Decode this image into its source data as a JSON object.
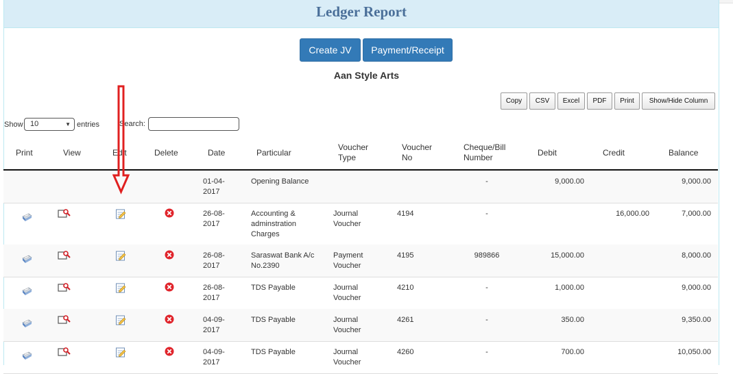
{
  "header": {
    "title": "Ledger Report"
  },
  "actions": {
    "create_jv": "Create JV",
    "payment_receipt": "Payment/Receipt"
  },
  "company": "Aan Style Arts",
  "toolbar": {
    "copy": "Copy",
    "csv": "CSV",
    "excel": "Excel",
    "pdf": "PDF",
    "print": "Print",
    "show_hide": "Show/Hide Column"
  },
  "length": {
    "show": "Show",
    "value": "10",
    "entries": "entries"
  },
  "search": {
    "label": "Search:",
    "value": ""
  },
  "columns": {
    "print": "Print",
    "view": "View",
    "edit": "Edit",
    "delete": "Delete",
    "date": "Date",
    "particular": "Particular",
    "voucher_type": "Voucher Type",
    "voucher_no": "Voucher No",
    "cheque": "Cheque/Bill Number",
    "debit": "Debit",
    "credit": "Credit",
    "balance": "Balance"
  },
  "rows": [
    {
      "date": "01-04-2017",
      "particular": "Opening Balance",
      "voucher_type": "",
      "voucher_no": "",
      "cheque": "-",
      "debit": "9,000.00",
      "credit": "",
      "balance": "9,000.00"
    },
    {
      "date": "26-08-2017",
      "particular": "Accounting & adminstration Charges",
      "voucher_type": "Journal Voucher",
      "voucher_no": "4194",
      "cheque": "-",
      "debit": "",
      "credit": "16,000.00",
      "balance": "7,000.00"
    },
    {
      "date": "26-08-2017",
      "particular": "Saraswat Bank A/c No.2390",
      "voucher_type": "Payment Voucher",
      "voucher_no": "4195",
      "cheque": "989866",
      "debit": "15,000.00",
      "credit": "",
      "balance": "8,000.00"
    },
    {
      "date": "26-08-2017",
      "particular": "TDS Payable",
      "voucher_type": "Journal Voucher",
      "voucher_no": "4210",
      "cheque": "-",
      "debit": "1,000.00",
      "credit": "",
      "balance": "9,000.00"
    },
    {
      "date": "04-09-2017",
      "particular": "TDS Payable",
      "voucher_type": "Journal Voucher",
      "voucher_no": "4261",
      "cheque": "-",
      "debit": "350.00",
      "credit": "",
      "balance": "9,350.00"
    },
    {
      "date": "04-09-2017",
      "particular": "TDS Payable",
      "voucher_type": "Journal Voucher",
      "voucher_no": "4260",
      "cheque": "-",
      "debit": "700.00",
      "credit": "",
      "balance": "10,050.00"
    }
  ],
  "colors": {
    "primary": "#337ab7",
    "heading_bg": "#d9edf7",
    "title": "#4a6f99",
    "annotation": "#e02020",
    "delete": "#e0242b"
  },
  "icons": {
    "print": "printer-icon",
    "view": "view-magnifier-icon",
    "edit": "edit-notepad-icon",
    "delete": "delete-x-icon"
  }
}
